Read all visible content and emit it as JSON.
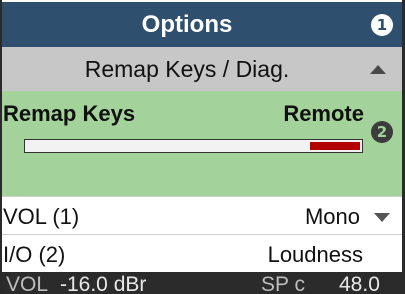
{
  "header": {
    "title": "Options",
    "badge": "1"
  },
  "submenu": {
    "label": "Remap Keys / Diag."
  },
  "selected_item": {
    "title": "Remap Keys",
    "value": "Remote",
    "badge": "2",
    "level_fraction": 0.15
  },
  "rows": [
    {
      "label": "VOL (1)",
      "value": "Mono"
    },
    {
      "label": "I/O (2)",
      "value": "Loudness"
    }
  ],
  "status": {
    "vol_label": "VOL",
    "vol_value": "-16.0 dBr",
    "sp_label": "SP c",
    "sp_value": "48.0"
  },
  "colors": {
    "header_bg": "#2e506e",
    "submenu_bg": "#c7c7c7",
    "selected_bg": "#a3d39a",
    "level_fill": "#b30000",
    "status_bg": "#2b2b2b"
  },
  "icons": {
    "scroll_up": "triangle-up-icon",
    "dropdown": "triangle-down-icon"
  }
}
